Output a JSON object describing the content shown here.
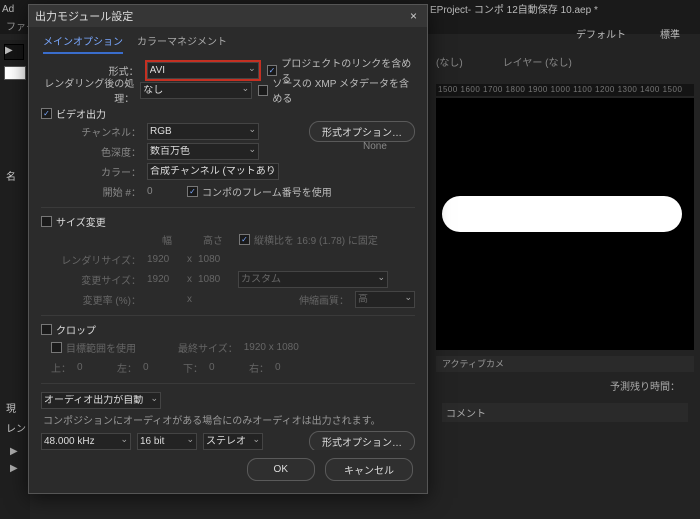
{
  "app": {
    "window_title_suffix": "EProject- コンポ 12自動保存 10.aep *",
    "menu_file": "ファイル",
    "defaults": "デフォルト",
    "standard": "標準",
    "panel_tab_nashi": "(なし)",
    "panel_layer": "レイヤー (なし)",
    "ruler": "1500   1600   1700   1800   1900   1000   1100   1200   1300   1400   1500",
    "left_name_col": "名",
    "left_current": "現",
    "left_render": "レン",
    "bottom_tab_active": "アクティブカメ",
    "pred_time": "予測残り時間：",
    "comment": "コメント"
  },
  "dialog": {
    "title": "出力モジュール設定",
    "tabs": {
      "main": "メインオプション",
      "color": "カラーマネジメント"
    },
    "format_label": "形式：",
    "format_value": "AVI",
    "postrender_label": "レンダリング後の処理：",
    "postrender_value": "なし",
    "include_project_link": "プロジェクトのリンクを含める",
    "include_source_xmp": "ソースの XMP メタデータを含める",
    "video_out": "ビデオ出力",
    "channel_label": "チャンネル：",
    "channel_value": "RGB",
    "format_options_btn": "形式オプション…",
    "depth_label": "色深度：",
    "depth_value": "数百万色",
    "none_text": "None",
    "color_label": "カラー：",
    "color_value": "合成チャンネル (マットあり)",
    "start_label": "開始 #：",
    "start_value": "0",
    "use_comp_frame": "コンポのフレーム番号を使用",
    "resize": "サイズ変更",
    "width": "幅",
    "height": "高さ",
    "lock_aspect": "縦横比を 16:9 (1.78) に固定",
    "render_size": "レンダリサイズ：",
    "rw": "1920",
    "rh": "1080",
    "resize_size": "変更サイズ：",
    "rsw": "1920",
    "rsh": "1080",
    "custom": "カスタム",
    "resize_pct": "変更率 (%)：",
    "x": "x",
    "scaling_quality": "伸縮画質：",
    "scaling_quality_value": "高",
    "crop": "クロップ",
    "use_roi": "目標範囲を使用",
    "final_size_label": "最終サイズ：",
    "final_size": "1920 x 1080",
    "top": "上：",
    "left": "左：",
    "bottom": "下：",
    "right": "右：",
    "zero": "0",
    "audio_auto": "オーディオ出力が自動",
    "audio_note": "コンポジションにオーディオがある場合にのみオーディオは出力されます。",
    "audio_hz": "48.000 kHz",
    "audio_bit": "16 bit",
    "audio_mode": "ステレオ",
    "ok": "OK",
    "cancel": "キャンセル"
  }
}
